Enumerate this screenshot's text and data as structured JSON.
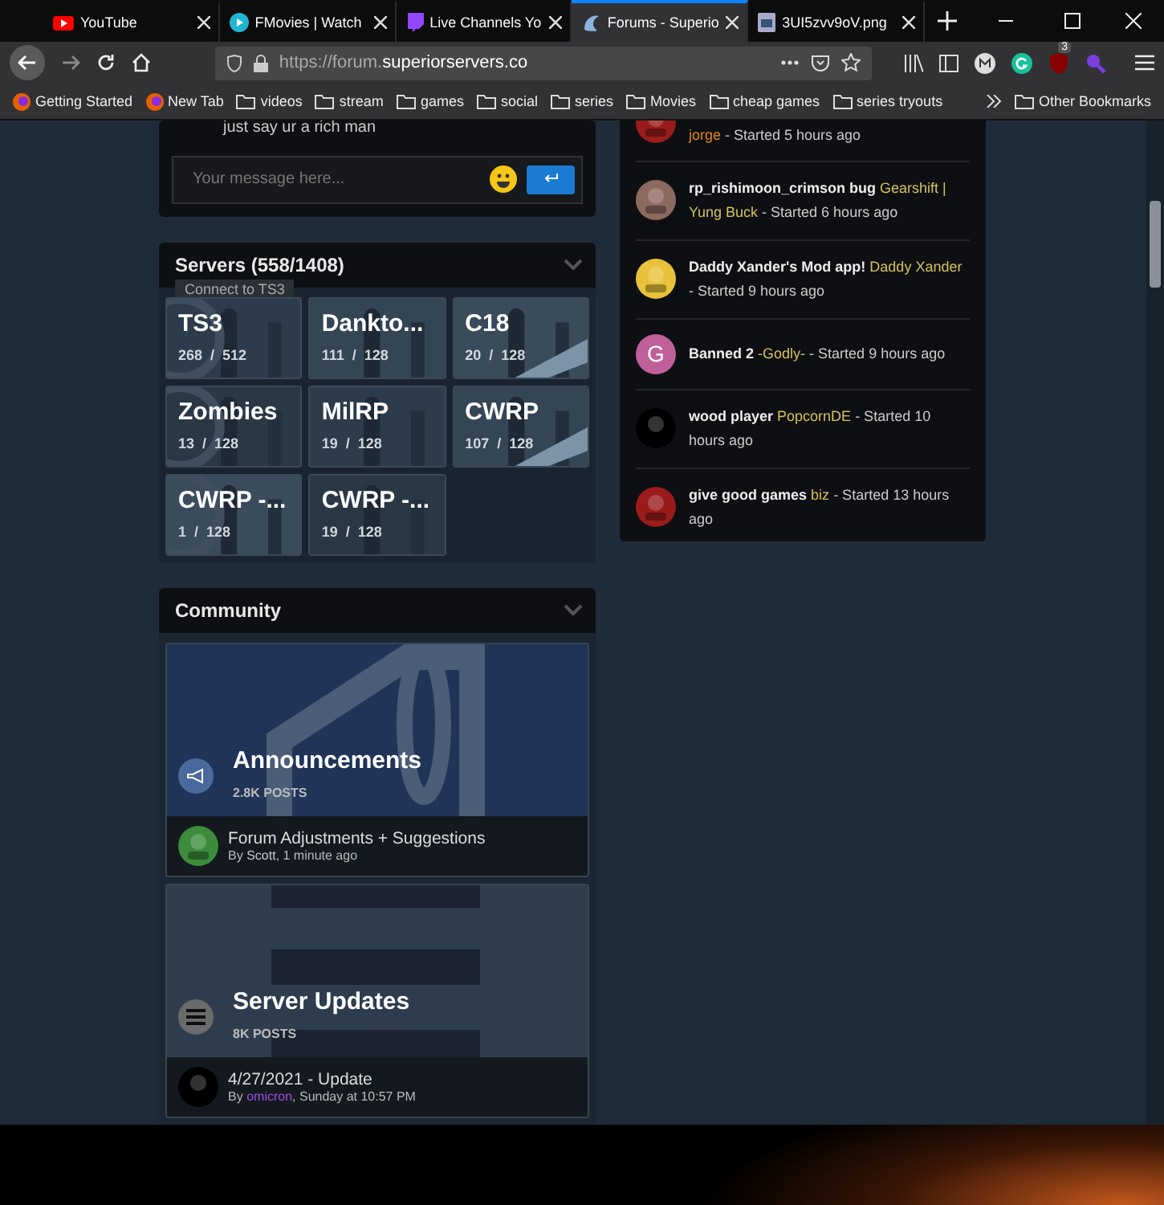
{
  "tabs": [
    {
      "title": "YouTube",
      "selected": false
    },
    {
      "title": "FMovies | Watch",
      "selected": false
    },
    {
      "title": "Live Channels Yo",
      "selected": false
    },
    {
      "title": "Forums - Superio",
      "selected": true
    },
    {
      "title": "3UI5zvv9oV.png",
      "selected": false
    }
  ],
  "address": {
    "prefix": "https://forum.",
    "domain": "superiorservers.co"
  },
  "extension_badge": "3",
  "bookmarks": [
    {
      "label": "Getting Started",
      "kind": "firefox"
    },
    {
      "label": "New Tab",
      "kind": "firefox"
    },
    {
      "label": "videos",
      "kind": "folder"
    },
    {
      "label": "stream",
      "kind": "folder"
    },
    {
      "label": "games",
      "kind": "folder"
    },
    {
      "label": "social",
      "kind": "folder"
    },
    {
      "label": "series",
      "kind": "folder"
    },
    {
      "label": "Movies",
      "kind": "folder"
    },
    {
      "label": "cheap games",
      "kind": "folder"
    },
    {
      "label": "series tryouts",
      "kind": "folder"
    }
  ],
  "other_bookmarks": "Other Bookmarks",
  "chat": {
    "last_message": "just say ur a rich man",
    "placeholder": "Your message here..."
  },
  "servers": {
    "title": "Servers (558/1408)",
    "tooltip": "Connect to TS3",
    "tiles": [
      {
        "name": "TS3",
        "players": "268  /  512"
      },
      {
        "name": "Dankto...",
        "players": "111  /  128"
      },
      {
        "name": "C18",
        "players": "20  /  128"
      },
      {
        "name": "Zombies",
        "players": "13  /  128"
      },
      {
        "name": "MilRP",
        "players": "19  /  128"
      },
      {
        "name": "CWRP",
        "players": "107  /  128"
      },
      {
        "name": "CWRP -...",
        "players": "1  /  128"
      },
      {
        "name": "CWRP -...",
        "players": "19  /  128"
      }
    ]
  },
  "community": {
    "title": "Community",
    "forums": [
      {
        "name": "Announcements",
        "posts": "2.8K POSTS",
        "latest": "Forum Adjustments + Suggestions",
        "by": "By",
        "author": "Scott",
        "color": "#c8ccd2",
        "when": ", 1 minute ago"
      },
      {
        "name": "Server Updates",
        "posts": "8K POSTS",
        "latest": "4/27/2021 - Update",
        "by": "By",
        "author": "omicron",
        "color": "#9b4fe0",
        "when": ", Sunday at 10:57 PM"
      }
    ]
  },
  "topics": [
    {
      "author": "jorge",
      "color": "#e0861c",
      "meta": " - Started 5 hours ago",
      "kind": "picture"
    },
    {
      "title": "rp_rishimoon_crimson bug",
      "author": "Gearshift | Yung Buck",
      "color": "#d6c35c",
      "meta": " - Started 6 hours ago",
      "kind": "picture"
    },
    {
      "title": "Daddy Xander's Mod app!",
      "author": "Daddy Xander",
      "color": "#d6c35c",
      "meta": " - Started 9 hours ago",
      "kind": "picture"
    },
    {
      "title": "Banned 2",
      "author": "-Godly-",
      "color": "#d6c35c",
      "meta": " - Started 9 hours ago",
      "kind": "letter",
      "letter": "G"
    },
    {
      "title": "wood player",
      "author": "PopcornDE",
      "color": "#d6c35c",
      "meta": " - Started 10 hours ago",
      "kind": "picture"
    },
    {
      "title": "give good games",
      "author": "biz",
      "color": "#d6c35c",
      "meta": " - Started 13 hours ago",
      "kind": "picture"
    }
  ]
}
